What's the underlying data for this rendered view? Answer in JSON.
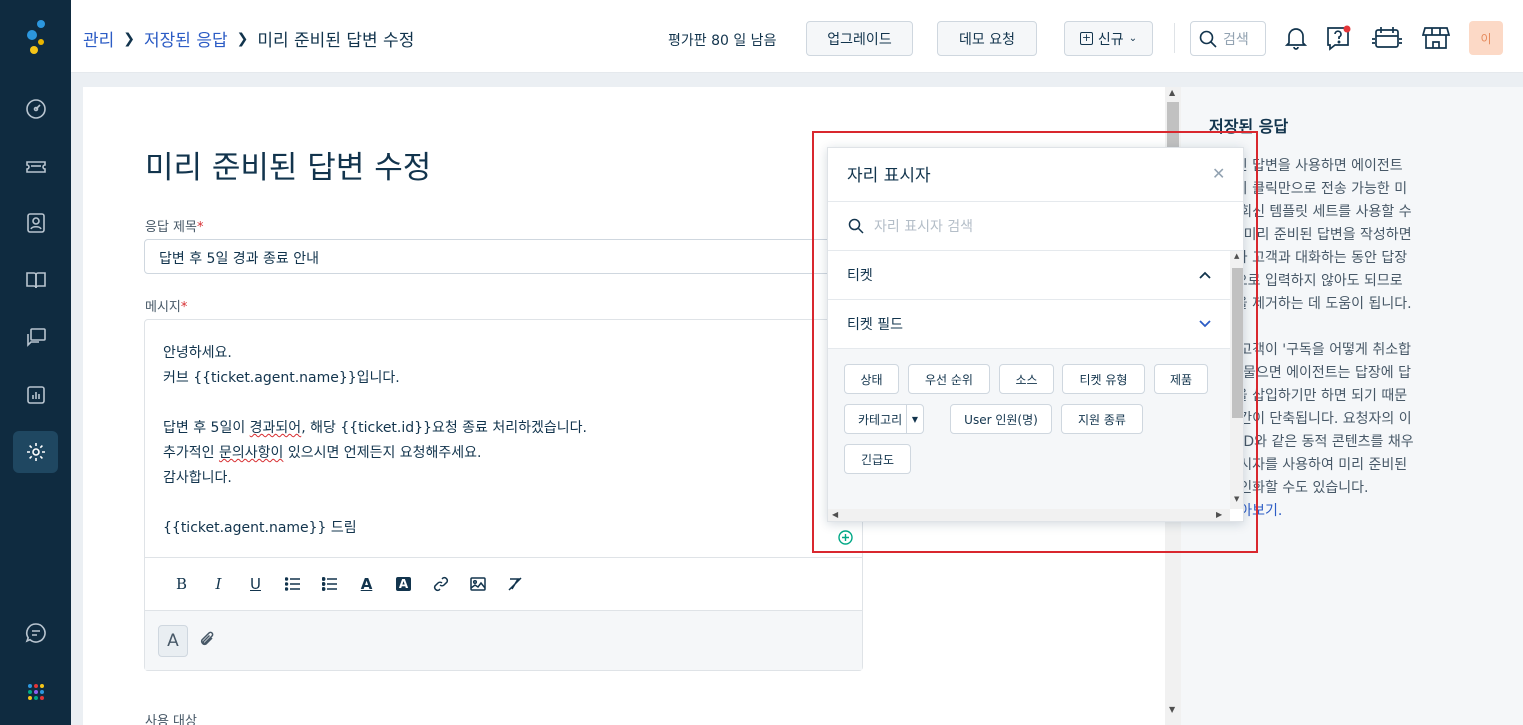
{
  "breadcrumb": {
    "items": [
      {
        "label": "관리"
      },
      {
        "label": "저장된 응답"
      },
      {
        "label": "미리 준비된 답변 수정"
      }
    ]
  },
  "topbar": {
    "trial_text": "평가판 80 일 남음",
    "upgrade_label": "업그레이드",
    "demo_label": "데모 요청",
    "new_label": "신규",
    "search_placeholder": "검색",
    "avatar_initial": "이"
  },
  "page": {
    "title": "미리 준비된 답변 수정",
    "subject_label": "응답 제목",
    "subject_value": "답변 후 5일 경과 종료 안내",
    "message_label": "메시지",
    "required_mark": "*",
    "next_label_partial": "사용 대상",
    "message": {
      "line1": "안녕하세요.",
      "line2": "커브 {{ticket.agent.name}}입니다.",
      "line4_a": "답변 후 5일이 ",
      "line4_b": "경과되어",
      "line4_c": ", 해당 {{ticket.id}}요청 종료 처리하겠습니다.",
      "line5_a": "추가적인 ",
      "line5_b": "문의사항이",
      "line5_c": " 있으시면 언제든지 요청해주세요.",
      "line6": "감사합니다.",
      "line8": "{{ticket.agent.name}} 드림"
    }
  },
  "placeholder_popup": {
    "title": "자리 표시자",
    "search_placeholder": "자리 표시자 검색",
    "sections": [
      {
        "label": "티켓",
        "expanded": true
      },
      {
        "label": "티켓 필드",
        "expanded": false
      }
    ],
    "tags": [
      "상태",
      "우선 순위",
      "소스",
      "티켓 유형",
      "제품",
      "카테고리",
      "User 인원(명)",
      "지원 종류",
      "긴급도"
    ]
  },
  "right_panel": {
    "title": "저장된 응답",
    "lines": [
      "준비된 답변을 사용하면 에이전트",
      "한번의 클릭만으로 전송 가능한 미",
      "의된 회신 템플릿 세트를 사용할 수",
      "니다. 미리 준비된 답변을 작성하면",
      "전트가 고객과 대화하는 동안 답장",
      "복적으로 입력하지 않아도 되므로",
      "작업을 제거하는 데 도움이 됩니다.",
      "",
      "들어 고객이 '구독을 어떻게 취소합",
      "'라고 물으면 에이전트는 답장에 답",
      "플릿을 삽입하기만 하면 되기 때문",
      "변 시간이 단축됩니다. 요청자의 이",
      "티켓 ID와 같은 동적 콘텐츠를 채우",
      "리 표시자를 사용하여 미리 준비된",
      "을 개인화할 수도 있습니다."
    ],
    "link_label": "히 알아보기."
  },
  "colors": {
    "sidebar_bg": "#0f2b40",
    "link": "#2c5cc5",
    "highlight_box": "#d9272e",
    "notification_dot": "#e43538"
  },
  "icons": {
    "sidebar": [
      "dashboard-icon",
      "tickets-icon",
      "contacts-icon",
      "solutions-icon",
      "forums-icon",
      "reports-icon",
      "admin-gear-icon",
      "chat-icon",
      "apps-grid-icon"
    ],
    "topbar": [
      "search-icon",
      "bell-icon",
      "help-icon",
      "calendar-icon",
      "marketplace-icon"
    ]
  }
}
